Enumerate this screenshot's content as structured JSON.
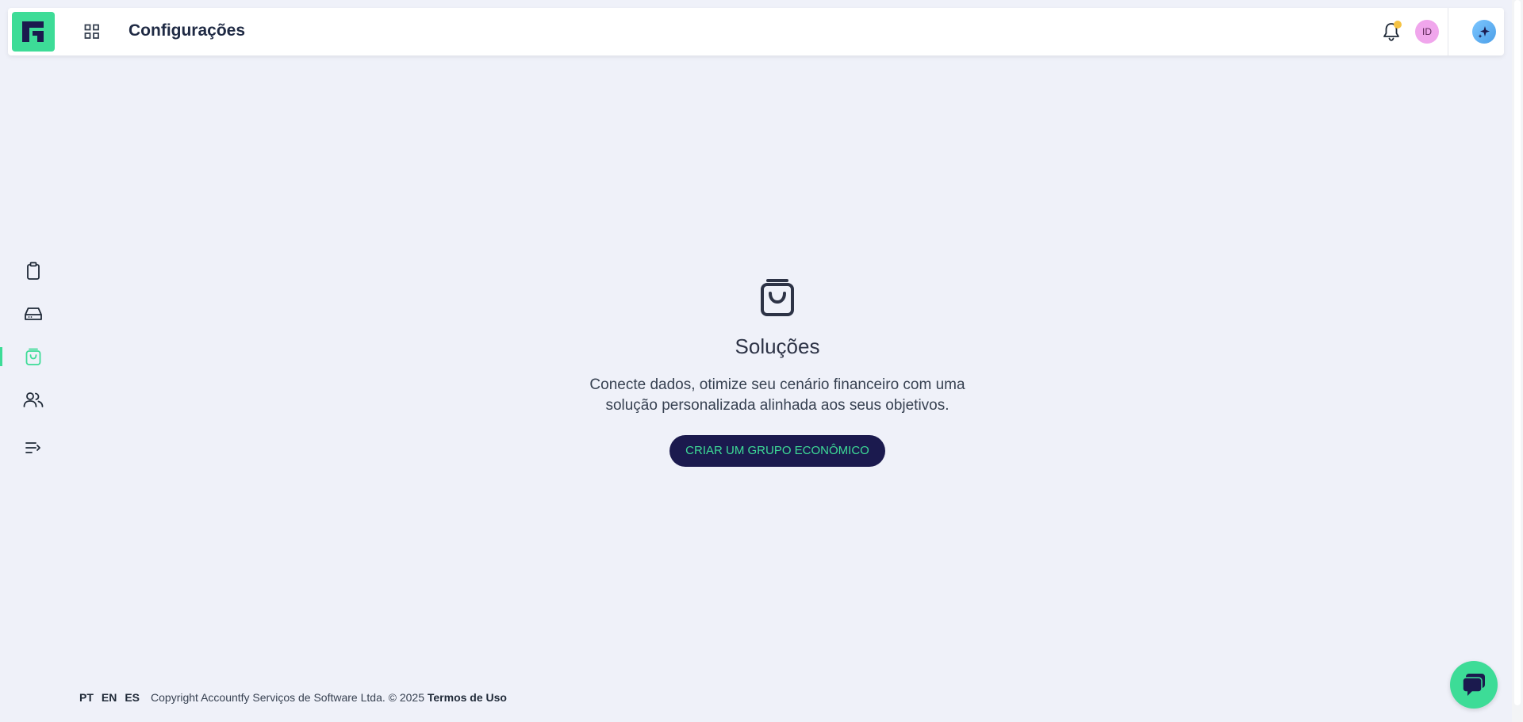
{
  "header": {
    "title": "Configurações",
    "avatar_initials": "ID"
  },
  "sidebar": {
    "items": [
      {
        "icon": "clipboard-icon"
      },
      {
        "icon": "hard-drive-icon"
      },
      {
        "icon": "shopping-bag-icon",
        "active": true
      },
      {
        "icon": "users-icon"
      },
      {
        "icon": "collapse-menu-icon"
      }
    ],
    "active_color": "#3ddc97"
  },
  "empty_state": {
    "icon": "shopping-bag-icon",
    "title": "Soluções",
    "description_line1": "Conecte dados, otimize seu cenário financeiro com uma",
    "description_line2": "solução personalizada alinhada aos seus objetivos.",
    "cta_label": "CRIAR UM GRUPO ECONÔMICO"
  },
  "footer": {
    "languages": [
      "PT",
      "EN",
      "ES"
    ],
    "copyright": "Copyright Accountfy Serviços de Software Ltda. © 2025",
    "terms": "Termos de Uso"
  },
  "colors": {
    "brand_green": "#3ddc97",
    "cta_background": "#1b1a4e",
    "notification_dot": "#f6c343"
  }
}
